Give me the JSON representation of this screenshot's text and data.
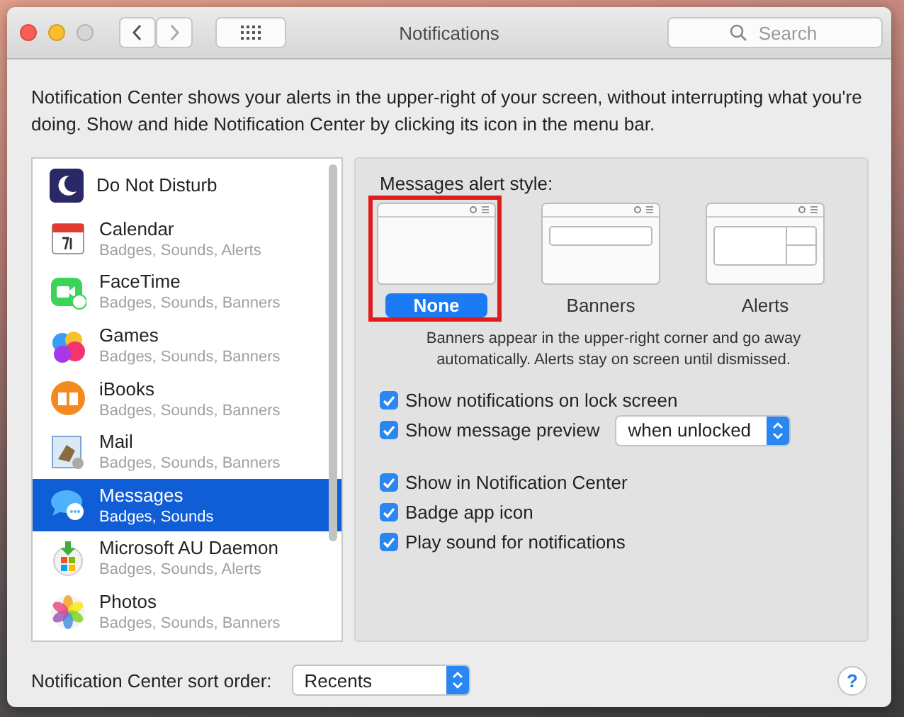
{
  "window": {
    "title": "Notifications",
    "search": {
      "placeholder": "Search"
    }
  },
  "description": "Notification Center shows your alerts in the upper-right of your screen, without interrupting what you're doing. Show and hide Notification Center by clicking its icon in the menu bar.",
  "apps": [
    {
      "name": "Do Not Disturb",
      "selected": false
    },
    {
      "name": "Calendar",
      "detail": "Badges, Sounds, Alerts",
      "selected": false
    },
    {
      "name": "FaceTime",
      "detail": "Badges, Sounds, Banners",
      "selected": false
    },
    {
      "name": "Games",
      "detail": "Badges, Sounds, Banners",
      "selected": false
    },
    {
      "name": "iBooks",
      "detail": "Badges, Sounds, Banners",
      "selected": false
    },
    {
      "name": "Mail",
      "detail": "Badges, Sounds, Banners",
      "selected": false
    },
    {
      "name": "Messages",
      "detail": "Badges, Sounds",
      "selected": true
    },
    {
      "name": "Microsoft AU Daemon",
      "detail": "Badges, Sounds, Alerts",
      "selected": false
    },
    {
      "name": "Photos",
      "detail": "Badges, Sounds, Banners",
      "selected": false
    }
  ],
  "alert_style": {
    "label": "Messages alert style:",
    "options": [
      {
        "label": "None",
        "kind": "none",
        "selected": true,
        "highlighted": true
      },
      {
        "label": "Banners",
        "kind": "banner",
        "selected": false,
        "highlighted": false
      },
      {
        "label": "Alerts",
        "kind": "alert",
        "selected": false,
        "highlighted": false
      }
    ],
    "note": "Banners appear in the upper-right corner and go away automatically. Alerts stay on screen until dismissed."
  },
  "lock_screen_options": [
    {
      "label": "Show notifications on lock screen",
      "checked": true
    },
    {
      "label": "Show message preview",
      "checked": true,
      "dropdown": "when unlocked"
    }
  ],
  "notification_options": [
    {
      "label": "Show in Notification Center",
      "checked": true
    },
    {
      "label": "Badge app icon",
      "checked": true
    },
    {
      "label": "Play sound for notifications",
      "checked": true
    }
  ],
  "sort_order": {
    "label": "Notification Center sort order:",
    "value": "Recents"
  },
  "help": "?"
}
